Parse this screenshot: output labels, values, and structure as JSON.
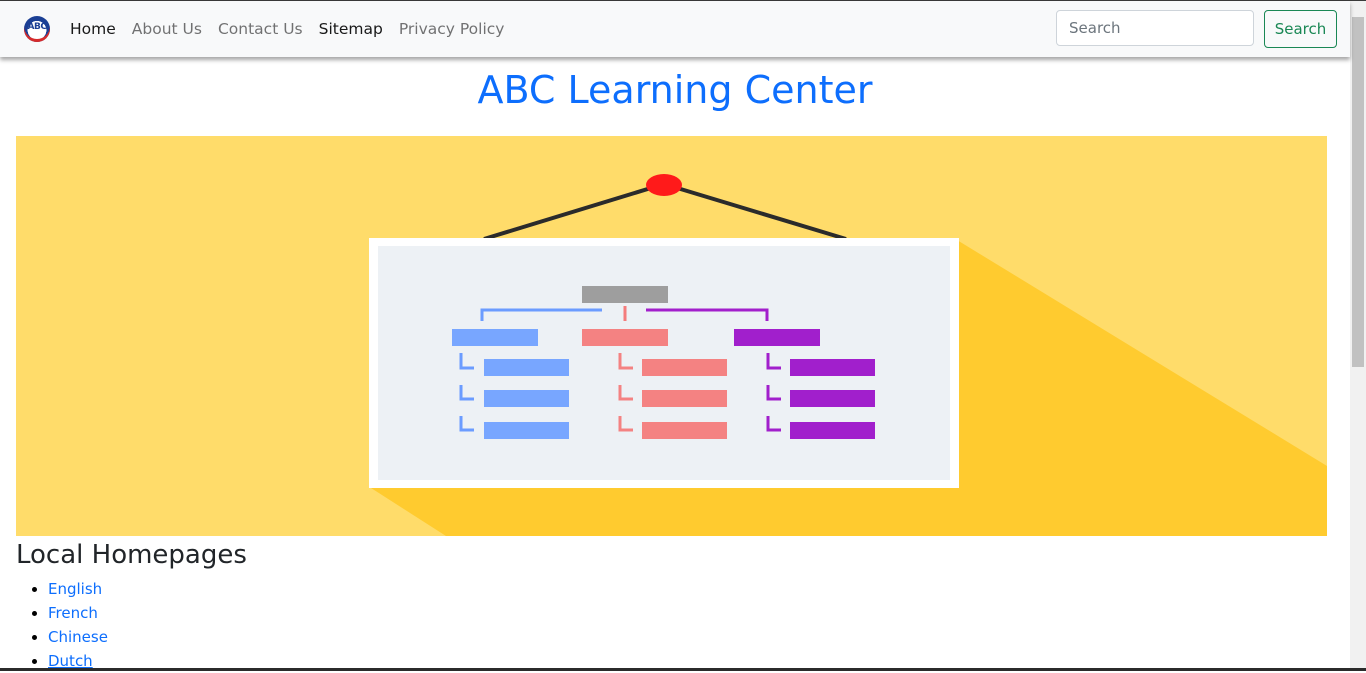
{
  "nav": {
    "logo_text": "ABC",
    "links": [
      "Home",
      "About Us",
      "Contact Us",
      "Sitemap",
      "Privacy Policy"
    ],
    "search_placeholder": "Search",
    "search_button": "Search"
  },
  "header": {
    "title": "ABC Learning Center"
  },
  "banner": {
    "icon": "org-chart-whiteboard-illustration"
  },
  "local_homepages": {
    "title": "Local Homepages",
    "items": [
      "English",
      "French",
      "Chinese",
      "Dutch"
    ]
  },
  "colors": {
    "accent": "#0d6efd",
    "success": "#198754",
    "banner_bg": "#ffdc6a"
  }
}
